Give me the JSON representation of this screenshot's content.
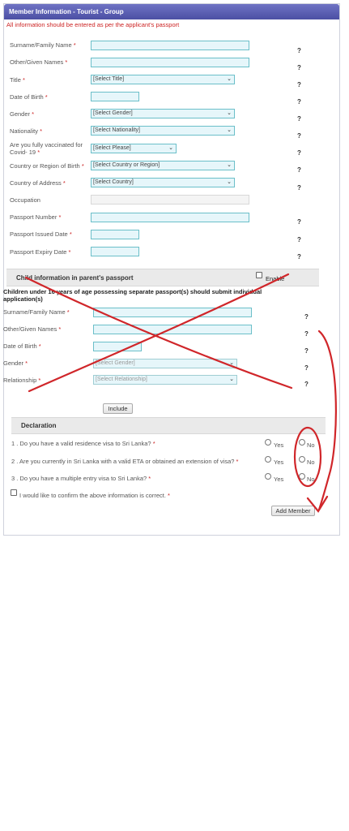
{
  "header": {
    "title": "Member Information - Tourist - Group"
  },
  "notice": "All information should be entered as per the applicant's passport",
  "req_marker": "*",
  "help_marker": "?",
  "member_form": {
    "surname_label": "Surname/Family Name",
    "given_label": "Other/Given Names",
    "title_label": "Title",
    "title_select": "[Select Title]",
    "dob_label": "Date of Birth",
    "gender_label": "Gender",
    "gender_select": "[Select Gender]",
    "nationality_label": "Nationality",
    "nationality_select": "[Select Nationality]",
    "vacc_label_1": "Are you fully vaccinated for",
    "vacc_label_2": "Covid- 19",
    "vacc_select": "[Select Please]",
    "birth_country_label": "Country or Region of Birth",
    "birth_country_select": "[Select Country or Region]",
    "address_country_label": "Country of Address",
    "address_country_select": "[Select Country]",
    "occupation_label": "Occupation",
    "passport_no_label": "Passport Number",
    "passport_issued_label": "Passport Issued Date",
    "passport_expiry_label": "Passport Expiry Date"
  },
  "child_section": {
    "title": "Child information in parent's passport",
    "enable_label": "Enable",
    "note_line1": "Children under 16 years of age possessing separate passport(s) should submit individual",
    "note_line2": "application(s)",
    "surname_label": "Surname/Family Name",
    "given_label": "Other/Given Names",
    "dob_label": "Date of Birth",
    "gender_label": "Gender",
    "gender_select": "[Select Gender]",
    "relationship_label": "Relationship",
    "relationship_select": "[Select Relationship]",
    "include_button": "Include"
  },
  "declaration": {
    "title": "Declaration",
    "questions": [
      {
        "text": "1 . Do you have a valid residence visa to Sri Lanka?",
        "yes": "Yes",
        "no": "No"
      },
      {
        "text": "2 . Are you currently in Sri Lanka with a valid ETA or obtained an extension of visa?",
        "yes": "Yes",
        "no": "No"
      },
      {
        "text": "3 . Do you have a multiple entry visa to Sri Lanka?",
        "yes": "Yes",
        "no": "No"
      }
    ],
    "confirm_label": "I would like to confirm the above information is correct.",
    "add_member_button": "Add Member"
  },
  "colors": {
    "header_start": "#6f73c4",
    "header_end": "#4b4fa4",
    "required": "#cc2222",
    "input_border": "#6bbfc9",
    "input_bg": "#e6f6fa",
    "annotation": "#d0262a"
  }
}
